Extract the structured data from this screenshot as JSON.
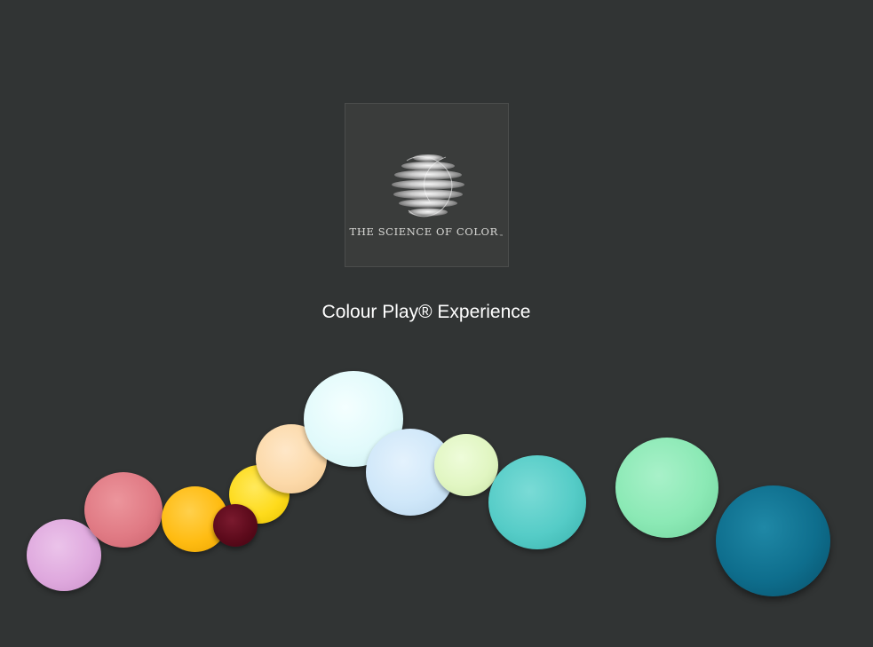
{
  "logo": {
    "icon": "striped-sphere-icon",
    "text": "THE SCIENCE OF COLOR",
    "trademark": "™"
  },
  "title": "Colour Play® Experience",
  "swatches": [
    {
      "name": "lilac",
      "color": "#e1aee0"
    },
    {
      "name": "coral-pink",
      "color": "#e27c85"
    },
    {
      "name": "marigold",
      "color": "#ffbe13"
    },
    {
      "name": "lemon",
      "color": "#fedb1f"
    },
    {
      "name": "peach",
      "color": "#fddcad"
    },
    {
      "name": "burgundy",
      "color": "#5f0a1c"
    },
    {
      "name": "ice-white",
      "color": "#e1fafb"
    },
    {
      "name": "powder-blue",
      "color": "#d0e8fa"
    },
    {
      "name": "pale-lime",
      "color": "#e3f8c4"
    },
    {
      "name": "turquoise",
      "color": "#57cdc8"
    },
    {
      "name": "mint",
      "color": "#8ceab6"
    },
    {
      "name": "deep-teal",
      "color": "#0f6f8e"
    }
  ]
}
